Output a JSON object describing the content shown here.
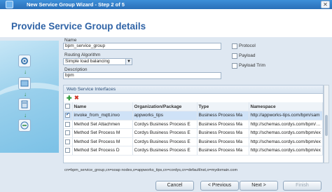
{
  "window": {
    "title": "New Service Group Wizard - Step 2 of 5",
    "close_glyph": "✕"
  },
  "page_title": "Provide Service Group details",
  "form": {
    "name_label": "Name",
    "name_value": "bpm_service_group",
    "routing_label": "Routing Algorithm",
    "routing_value": "Simple load balancing",
    "description_label": "Description",
    "description_value": "bpm",
    "options": [
      {
        "label": "Protocol",
        "checked": false
      },
      {
        "label": "Payload",
        "checked": false
      },
      {
        "label": "Payload Trim",
        "checked": false
      }
    ]
  },
  "web_service_interfaces": {
    "header": "Web Service Interfaces",
    "columns": [
      "Name",
      "Organization/Package",
      "Type",
      "Namespace"
    ],
    "rows": [
      {
        "checked": true,
        "name": "invoke_from_mqtt.invo",
        "org": "appworks_tips",
        "type": "Business Process Ma",
        "ns": "http://appworks-tips.com/bpm/sam"
      },
      {
        "checked": false,
        "name": "Method Set Attachmen",
        "org": "Cordys Business Process E",
        "type": "Business Process Ma",
        "ns": "http://schemas.cordys.com/bpm/att"
      },
      {
        "checked": false,
        "name": "Method Set Process M",
        "org": "Cordys Business Process E",
        "type": "Business Process Ma",
        "ns": "http://schemas.cordys.com/bpm/ex"
      },
      {
        "checked": false,
        "name": "Method Set Process M",
        "org": "Cordys Business Process E",
        "type": "Business Process Ma",
        "ns": "http://schemas.cordys.com/bpm/ex"
      },
      {
        "checked": false,
        "name": "Method Set Process D",
        "org": "Cordys Business Process E",
        "type": "Business Process Ma",
        "ns": "http://schemas.cordys.com/bpm/ex"
      }
    ]
  },
  "dn_text": "cn=bpm_service_group,cn=soap nodes,o=appworks_tips,cn=cordys,cn=defaultInst,o=mydomain.com",
  "buttons": {
    "cancel": "Cancel",
    "previous": "< Previous",
    "next": "Next >",
    "finish": "Finish"
  },
  "colors": {
    "title_bar": "#2a6fb8",
    "heading": "#2f63a6",
    "selected_row": "#cfe2f7"
  }
}
